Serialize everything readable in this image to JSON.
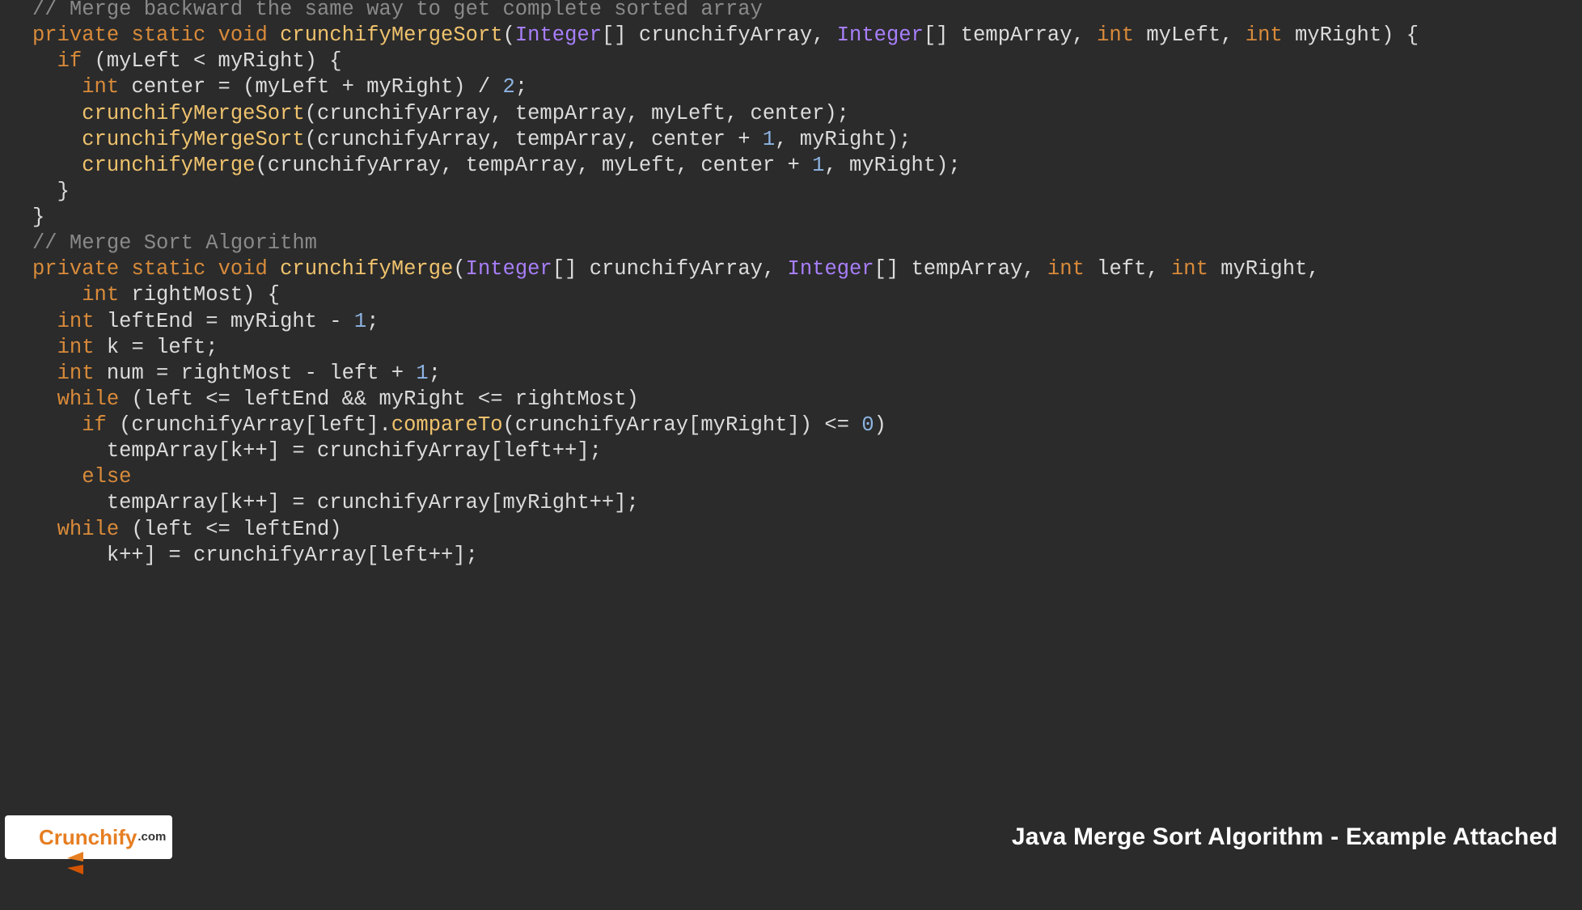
{
  "code": {
    "lines": [
      {
        "indent": 0,
        "tokens": [
          [
            "comment",
            "// Merge backward the same way to get complete sorted array"
          ]
        ]
      },
      {
        "indent": 0,
        "tokens": [
          [
            "kw",
            "private"
          ],
          [
            "plain",
            " "
          ],
          [
            "kw",
            "static"
          ],
          [
            "plain",
            " "
          ],
          [
            "kw",
            "void"
          ],
          [
            "plain",
            " "
          ],
          [
            "func",
            "crunchifyMergeSort"
          ],
          [
            "plain",
            "("
          ],
          [
            "violet",
            "Integer"
          ],
          [
            "plain",
            "[] crunchifyArray, "
          ],
          [
            "violet",
            "Integer"
          ],
          [
            "plain",
            "[] tempArray, "
          ],
          [
            "kw",
            "int"
          ],
          [
            "plain",
            " myLeft, "
          ],
          [
            "kw",
            "int"
          ],
          [
            "plain",
            " myRight) {"
          ]
        ]
      },
      {
        "indent": 0,
        "tokens": [
          [
            "plain",
            ""
          ]
        ]
      },
      {
        "indent": 1,
        "tokens": [
          [
            "kw",
            "if"
          ],
          [
            "plain",
            " (myLeft < myRight) {"
          ]
        ]
      },
      {
        "indent": 2,
        "tokens": [
          [
            "kw",
            "int"
          ],
          [
            "plain",
            " center = (myLeft + myRight) / "
          ],
          [
            "num",
            "2"
          ],
          [
            "plain",
            ";"
          ]
        ]
      },
      {
        "indent": 2,
        "tokens": [
          [
            "func",
            "crunchifyMergeSort"
          ],
          [
            "plain",
            "(crunchifyArray, tempArray, myLeft, center);"
          ]
        ]
      },
      {
        "indent": 2,
        "tokens": [
          [
            "func",
            "crunchifyMergeSort"
          ],
          [
            "plain",
            "(crunchifyArray, tempArray, center + "
          ],
          [
            "num",
            "1"
          ],
          [
            "plain",
            ", myRight);"
          ]
        ]
      },
      {
        "indent": 2,
        "tokens": [
          [
            "func",
            "crunchifyMerge"
          ],
          [
            "plain",
            "(crunchifyArray, tempArray, myLeft, center + "
          ],
          [
            "num",
            "1"
          ],
          [
            "plain",
            ", myRight);"
          ]
        ]
      },
      {
        "indent": 1,
        "tokens": [
          [
            "plain",
            "}"
          ]
        ]
      },
      {
        "indent": 0,
        "tokens": [
          [
            "plain",
            "}"
          ]
        ]
      },
      {
        "indent": 0,
        "tokens": [
          [
            "plain",
            ""
          ]
        ]
      },
      {
        "indent": 0,
        "tokens": [
          [
            "comment",
            "// Merge Sort Algorithm"
          ]
        ]
      },
      {
        "indent": 0,
        "tokens": [
          [
            "kw",
            "private"
          ],
          [
            "plain",
            " "
          ],
          [
            "kw",
            "static"
          ],
          [
            "plain",
            " "
          ],
          [
            "kw",
            "void"
          ],
          [
            "plain",
            " "
          ],
          [
            "func",
            "crunchifyMerge"
          ],
          [
            "plain",
            "("
          ],
          [
            "violet",
            "Integer"
          ],
          [
            "plain",
            "[] crunchifyArray, "
          ],
          [
            "violet",
            "Integer"
          ],
          [
            "plain",
            "[] tempArray, "
          ],
          [
            "kw",
            "int"
          ],
          [
            "plain",
            " left, "
          ],
          [
            "kw",
            "int"
          ],
          [
            "plain",
            " myRight,"
          ]
        ]
      },
      {
        "indent": 2,
        "tokens": [
          [
            "kw",
            "int"
          ],
          [
            "plain",
            " rightMost) {"
          ]
        ]
      },
      {
        "indent": 1,
        "tokens": [
          [
            "kw",
            "int"
          ],
          [
            "plain",
            " leftEnd = myRight - "
          ],
          [
            "num",
            "1"
          ],
          [
            "plain",
            ";"
          ]
        ]
      },
      {
        "indent": 1,
        "tokens": [
          [
            "kw",
            "int"
          ],
          [
            "plain",
            " k = left;"
          ]
        ]
      },
      {
        "indent": 1,
        "tokens": [
          [
            "kw",
            "int"
          ],
          [
            "plain",
            " num = rightMost - left + "
          ],
          [
            "num",
            "1"
          ],
          [
            "plain",
            ";"
          ]
        ]
      },
      {
        "indent": 0,
        "tokens": [
          [
            "plain",
            ""
          ]
        ]
      },
      {
        "indent": 1,
        "tokens": [
          [
            "kw",
            "while"
          ],
          [
            "plain",
            " (left <= leftEnd && myRight <= rightMost)"
          ]
        ]
      },
      {
        "indent": 2,
        "tokens": [
          [
            "kw",
            "if"
          ],
          [
            "plain",
            " (crunchifyArray[left]."
          ],
          [
            "func",
            "compareTo"
          ],
          [
            "plain",
            "(crunchifyArray[myRight]) <= "
          ],
          [
            "num",
            "0"
          ],
          [
            "plain",
            ")"
          ]
        ]
      },
      {
        "indent": 3,
        "tokens": [
          [
            "plain",
            "tempArray[k++] = crunchifyArray[left++];"
          ]
        ]
      },
      {
        "indent": 2,
        "tokens": [
          [
            "kw",
            "else"
          ]
        ]
      },
      {
        "indent": 3,
        "tokens": [
          [
            "plain",
            "tempArray[k++] = crunchifyArray[myRight++];"
          ]
        ]
      },
      {
        "indent": 0,
        "tokens": [
          [
            "plain",
            ""
          ]
        ]
      },
      {
        "indent": 1,
        "tokens": [
          [
            "kw",
            "while"
          ],
          [
            "plain",
            " (left <= leftEnd)"
          ]
        ]
      },
      {
        "indent": 3,
        "tokens": [
          [
            "plain",
            "k++] = crunchifyArray[left++];"
          ]
        ]
      }
    ]
  },
  "footer": {
    "caption": "Java Merge Sort Algorithm - Example Attached"
  },
  "logo": {
    "brand": "Crunchify",
    "suffix": ".com"
  }
}
